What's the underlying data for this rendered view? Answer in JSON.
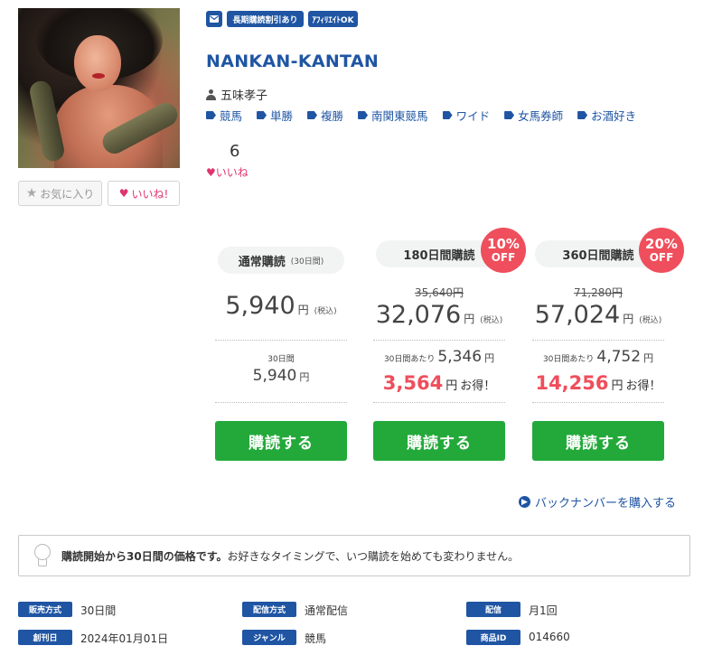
{
  "tags": {
    "mail_icon": "envelope-icon",
    "long_term": "長期購読割引あり",
    "affiliate": "ｱﾌｨﾘｴｲﾄOK"
  },
  "title": "NANKAN-KANTAN",
  "author": "五味孝子",
  "genres": [
    "競馬",
    "単勝",
    "複勝",
    "南関東競馬",
    "ワイド",
    "女馬券師",
    "お酒好き"
  ],
  "likes": {
    "count": "6",
    "label": "いいね"
  },
  "buttons": {
    "favorite": "お気に入り",
    "like": "いいね!"
  },
  "plans": [
    {
      "name": "通常購読",
      "period": "(30日間)",
      "badge_pct": "",
      "badge_off": "",
      "old_price": "",
      "price": "5,940",
      "yen": "円",
      "tax": "(税込)",
      "per_label": "30日間",
      "per_price": "5,940",
      "per_yen": "円",
      "save_amount": "",
      "save_yen": "",
      "save_text": "",
      "buy": "購読する"
    },
    {
      "name": "180日間購読",
      "period": "",
      "badge_pct": "10%",
      "badge_off": "OFF",
      "old_price": "35,640円",
      "price": "32,076",
      "yen": "円",
      "tax": "(税込)",
      "per_label": "30日間あたり",
      "per_price": "5,346",
      "per_yen": "円",
      "save_amount": "3,564",
      "save_yen": "円",
      "save_text": "お得！",
      "buy": "購読する"
    },
    {
      "name": "360日間購読",
      "period": "",
      "badge_pct": "20%",
      "badge_off": "OFF",
      "old_price": "71,280円",
      "price": "57,024",
      "yen": "円",
      "tax": "(税込)",
      "per_label": "30日間あたり",
      "per_price": "4,752",
      "per_yen": "円",
      "save_amount": "14,256",
      "save_yen": "円",
      "save_text": "お得！",
      "buy": "購読する"
    }
  ],
  "backnumber": "バックナンバーを購入する",
  "notice": {
    "bold": "購読開始から30日間の価格です。",
    "text": "お好きなタイミングで、いつ購読を始めても変わりません。"
  },
  "meta": [
    {
      "label": "販売方式",
      "value": "30日間"
    },
    {
      "label": "配信方式",
      "value": "通常配信"
    },
    {
      "label": "配信",
      "value": "月1回"
    },
    {
      "label": "創刊日",
      "value": "2024年01月01日"
    },
    {
      "label": "ジャンル",
      "value": "競馬"
    },
    {
      "label": "商品ID",
      "value": "014660"
    }
  ],
  "colors": {
    "brand": "#1f55a3",
    "buy": "#23a93a",
    "discount": "#ef4e5c",
    "like": "#e0336f"
  }
}
